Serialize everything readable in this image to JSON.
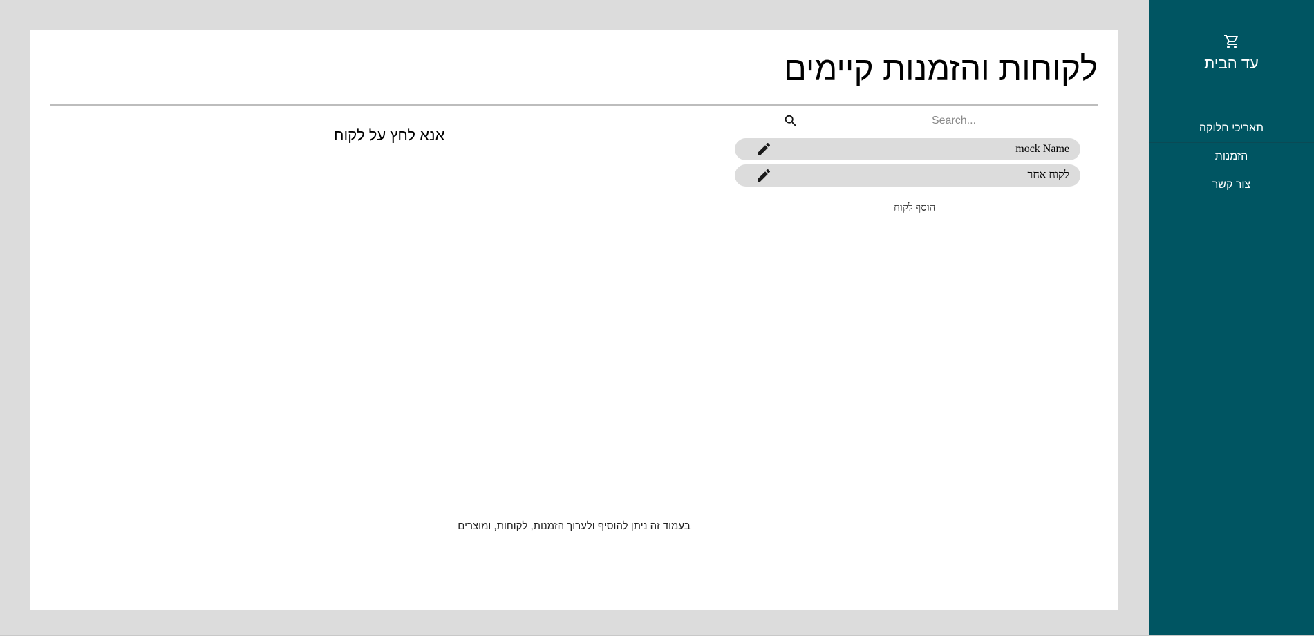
{
  "brand": {
    "name": "עד הבית",
    "icon": "cart-icon"
  },
  "nav": {
    "items": [
      {
        "label": "תאריכי חלוקה"
      },
      {
        "label": "הזמנות"
      },
      {
        "label": "צור קשר"
      }
    ]
  },
  "page": {
    "title": "לקוחות והזמנות קיימים"
  },
  "search": {
    "placeholder": "Search...",
    "value": "",
    "icon": "search-icon"
  },
  "customers": [
    {
      "name": "mock Name",
      "icon": "edit-icon"
    },
    {
      "name": "לקוח אחר",
      "icon": "edit-icon"
    }
  ],
  "add_customer_label": "הוסף לקוח",
  "detail": {
    "empty_message": "אנא לחץ על לקוח"
  },
  "footer": {
    "note": "בעמוד זה ניתן להוסיף ולערוך הזמנות, לקוחות, ומוצרים"
  },
  "colors": {
    "sidebar": "#005562",
    "background": "#dcdcdc",
    "row": "#dcdcdc"
  }
}
